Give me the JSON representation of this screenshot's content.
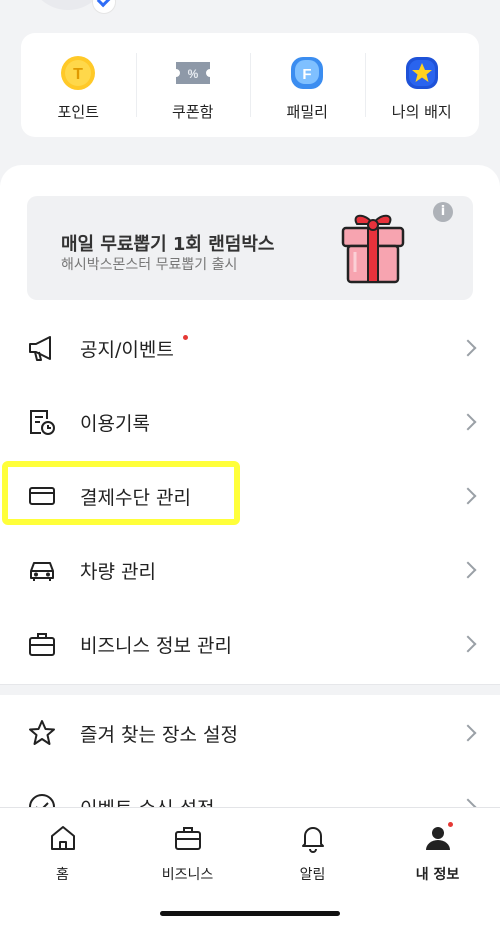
{
  "quick_menu": {
    "items": [
      {
        "label": "포인트",
        "icon": "point-coin-icon",
        "badge": "T"
      },
      {
        "label": "쿠폰함",
        "icon": "coupon-icon",
        "badge": "%"
      },
      {
        "label": "패밀리",
        "icon": "family-icon",
        "badge": "F"
      },
      {
        "label": "나의 배지",
        "icon": "badge-star-icon",
        "badge": "★"
      }
    ]
  },
  "banner": {
    "title": "매일 무료뽑기 1회 랜덤박스",
    "subtitle": "해시박스몬스터 무료뽑기 출시",
    "info_icon": "i"
  },
  "menu": {
    "items": [
      {
        "label": "공지/이벤트",
        "icon": "megaphone-icon",
        "dot": true
      },
      {
        "label": "이용기록",
        "icon": "history-icon"
      },
      {
        "label": "결제수단 관리",
        "icon": "card-icon"
      },
      {
        "label": "차량 관리",
        "icon": "car-icon"
      },
      {
        "label": "비즈니스 정보 관리",
        "icon": "briefcase-icon"
      },
      {
        "label": "즐겨 찾는 장소 설정",
        "icon": "star-icon"
      },
      {
        "label": "이벤트 수신 설정",
        "icon": "check-circle-icon"
      }
    ]
  },
  "tabbar": {
    "items": [
      {
        "label": "홈",
        "icon": "home-icon",
        "active": false
      },
      {
        "label": "비즈니스",
        "icon": "briefcase-icon",
        "active": false
      },
      {
        "label": "알림",
        "icon": "bell-icon",
        "active": false
      },
      {
        "label": "내 정보",
        "icon": "person-icon",
        "active": true
      }
    ]
  },
  "colors": {
    "highlight": "#ffff3a",
    "notification_dot": "#e53935",
    "coin": "#ffc928",
    "family": "#3b8df0",
    "badge_blue": "#1e52d8"
  }
}
